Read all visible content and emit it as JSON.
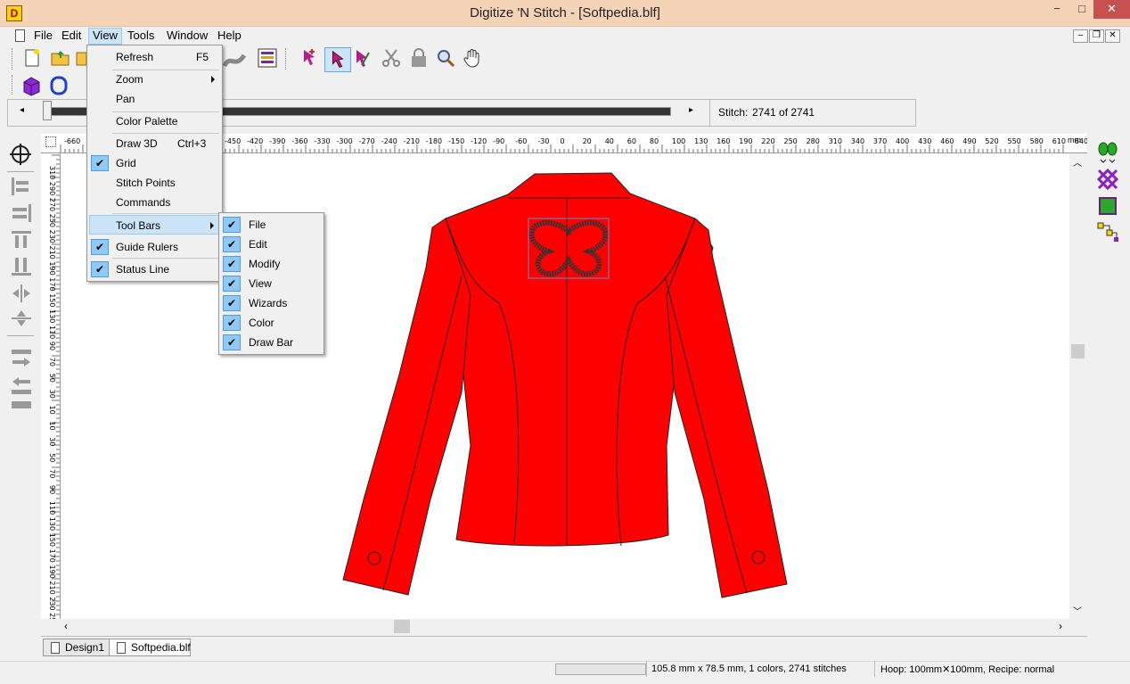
{
  "window": {
    "title": "Digitize 'N Stitch - [Softpedia.blf]",
    "icon_letter": "D",
    "min": "−",
    "max": "□",
    "close": "✕"
  },
  "menubar": {
    "items": [
      "File",
      "Edit",
      "View",
      "Tools",
      "Window",
      "Help"
    ],
    "mdi": [
      "–",
      "❐",
      "✕"
    ]
  },
  "view_menu": {
    "items": [
      {
        "label": "Refresh",
        "shortcut": "F5"
      },
      {
        "label": "Zoom",
        "submenu": true
      },
      {
        "label": "Pan"
      },
      {
        "label": "Color Palette"
      },
      {
        "label": "Draw 3D",
        "shortcut": "Ctrl+3"
      },
      {
        "label": "Grid",
        "checked": true
      },
      {
        "label": "Stitch Points"
      },
      {
        "label": "Commands"
      },
      {
        "label": "Tool Bars",
        "submenu": true
      },
      {
        "label": "Guide Rulers",
        "checked": true
      },
      {
        "label": "Status Line",
        "checked": true
      }
    ]
  },
  "toolbars_submenu": {
    "items": [
      "File",
      "Edit",
      "Modify",
      "View",
      "Wizards",
      "Color",
      "Draw Bar"
    ]
  },
  "player": {
    "prev": "◂",
    "next": "▸",
    "stitch_label": "Stitch:",
    "stitch_value": "2741 of 2741"
  },
  "ruler": {
    "unit": "mm",
    "top_ticks": [
      "-660",
      "-450",
      "-420",
      "-390",
      "-360",
      "-330",
      "-300",
      "-270",
      "-240",
      "-210",
      "-180",
      "-150",
      "-120",
      "-90",
      "-60",
      "-30",
      "0",
      "20",
      "40",
      "60",
      "80",
      "100",
      "130",
      "160",
      "190",
      "220",
      "250",
      "280",
      "310",
      "340",
      "370",
      "400",
      "430",
      "460",
      "490",
      "520",
      "550",
      "580",
      "610",
      "640"
    ],
    "left_ticks": [
      "310",
      "290",
      "270",
      "250",
      "230",
      "210",
      "190",
      "170",
      "150",
      "130",
      "110",
      "90",
      "70",
      "50",
      "30",
      "10",
      "10",
      "30",
      "50",
      "70",
      "90",
      "110",
      "130",
      "150",
      "170",
      "190",
      "210",
      "230",
      "250"
    ]
  },
  "tabs": [
    "Design1",
    "Softpedia.blf"
  ],
  "status": {
    "design_info": "105.8 mm x 78.5 mm, 1 colors, 2741 stitches",
    "hoop_info": "Hoop: 100mm✕100mm, Recipe: normal"
  },
  "colors": {
    "jacket": "#ff0000",
    "titlebar": "#f5d3b7",
    "menu_highlight": "#cce4f7"
  }
}
